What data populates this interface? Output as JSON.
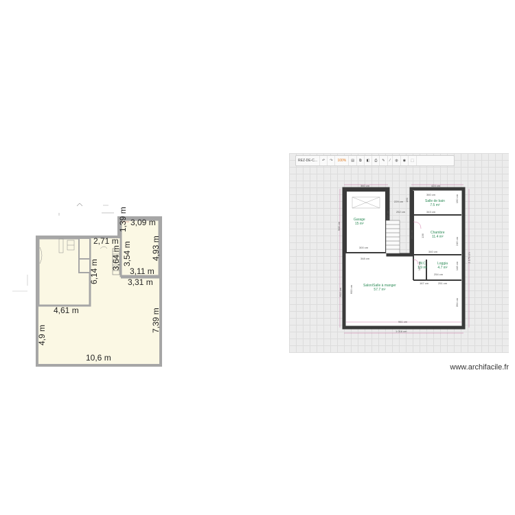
{
  "left_plan": {
    "dimensions": [
      "3,09 m",
      "1,39 m",
      "2,71 m",
      "4,93 m",
      "3,54 m",
      "3,64 m",
      "6,14 m",
      "3,11 m",
      "3,31 m",
      "4,61 m",
      "7,39 m",
      "4,9 m",
      "10,6 m"
    ]
  },
  "toolbar": {
    "title": "REZ-DE-C...",
    "zoom": "100%"
  },
  "right_plan": {
    "rooms": [
      {
        "name": "Garage",
        "area": "15 m²"
      },
      {
        "name": "Salle de bain",
        "area": "7.5 m²"
      },
      {
        "name": "Chambre",
        "area": "11.4 m²"
      },
      {
        "name": "W.C",
        "area": "1.9 m²"
      },
      {
        "name": "Loggia",
        "area": "4.7 m²"
      },
      {
        "name": "Salon/Salle à manger",
        "area": "57.7 m²"
      }
    ],
    "dims": {
      "top_left": "360 cm",
      "top_right": "424 cm",
      "sdb_w": "360 cm",
      "sdb_w2": "343 cm",
      "passage": "229 cm",
      "passage2": "252 cm",
      "garage_w": "300 cm",
      "garage_w2": "348 cm",
      "chambre_w": "340 cm",
      "loggia_w": "254 cm",
      "loggia_w2": "251 cm",
      "wc_w": "167 cm",
      "bottom_inner": "961 cm",
      "bottom_outer": "1 016 cm",
      "left_outer": "908 cm",
      "left_inner": "612 cm",
      "salon_h": "600 cm",
      "right_outer": "1 173 cm",
      "right_inner": "394 cm",
      "h150": "150 cm",
      "h146": "146 cm",
      "h245": "245 cm",
      "h148": "148 cm",
      "h506": "506 cm",
      "h260": "260 cm",
      "v160": "160",
      "v136": "136"
    }
  },
  "watermark": "www.archifacile.fr"
}
